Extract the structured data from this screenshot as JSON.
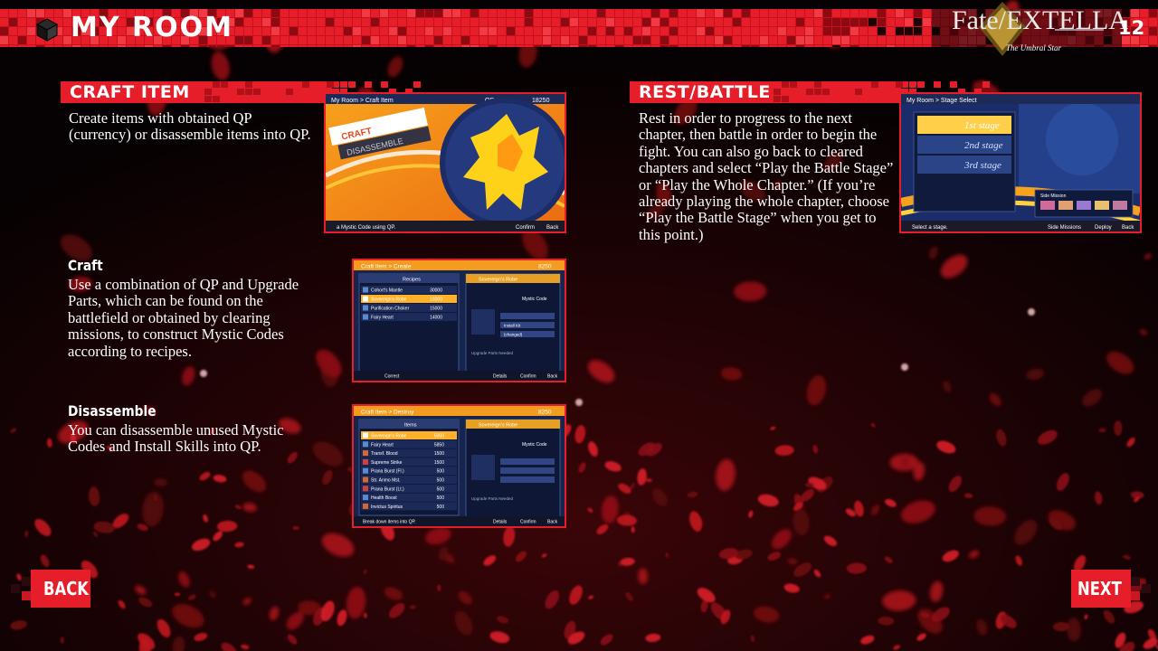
{
  "header": {
    "title": "MY ROOM",
    "page_number": "12",
    "logo": {
      "main": "Fate/EXTELLA",
      "sub": "The Umbral Star"
    }
  },
  "craft_item": {
    "heading": "CRAFT ITEM",
    "description": "Create items with obtained QP (currency) or disassemble items into QP.",
    "screenshot": {
      "breadcrumb": "My Room > Craft Item",
      "qp_label": "QP",
      "qp_value": "18250",
      "menu": [
        "CRAFT",
        "DISASSEMBLE"
      ],
      "footer_hint": "a Mystic Code using QP.",
      "footer_buttons": [
        "Confirm",
        "Back"
      ]
    }
  },
  "craft": {
    "heading": "Craft",
    "description": "Use a combination of QP and Upgrade Parts, which can be found on the battlefield or obtained by clearing missions, to construct Mystic Codes according to recipes.",
    "screenshot": {
      "breadcrumb": "Craft Item > Create",
      "qp_value": "8250",
      "list_title": "Recipes",
      "recipes": [
        {
          "name": "Cohort's Mantle",
          "cost": "30000"
        },
        {
          "name": "Sovereign's Robe",
          "cost": "15000"
        },
        {
          "name": "Purification Choker",
          "cost": "15000"
        },
        {
          "name": "Fairy Heart",
          "cost": "14000"
        }
      ],
      "detail_title": "Sovereign's Robe",
      "detail_label": "Mystic Code",
      "detail_rows": [
        "Install Kit",
        "(changed)"
      ],
      "parts_label": "Upgrade Parts Needed",
      "footer_left": "Correct",
      "footer_buttons": [
        "Details",
        "Confirm",
        "Back"
      ]
    }
  },
  "disassemble": {
    "heading": "Disassemble",
    "description": "You can disassemble unused Mystic Codes and Install Skills into QP.",
    "screenshot": {
      "breadcrumb": "Craft Item > Destroy",
      "qp_value": "8250",
      "list_title": "Items",
      "items": [
        {
          "name": "Sovereign's Robe",
          "cost": "5000"
        },
        {
          "name": "Fairy Heart",
          "cost": "5850"
        },
        {
          "name": "Transf. Blood",
          "cost": "1500"
        },
        {
          "name": "Supreme Strike",
          "cost": "1500"
        },
        {
          "name": "Prana Burst (Fl.)",
          "cost": "500"
        },
        {
          "name": "Str. Anmo Mst.",
          "cost": "500"
        },
        {
          "name": "Prana Burst (Lt.)",
          "cost": "500"
        },
        {
          "name": "Health Boost",
          "cost": "500"
        },
        {
          "name": "Invictus Spiritus",
          "cost": "500"
        }
      ],
      "detail_title": "Sovereign's Robe",
      "detail_label": "Mystic Code",
      "parts_label": "Upgrade Parts Needed",
      "footer_left": "Break down items into QP.",
      "footer_buttons": [
        "Details",
        "Confirm",
        "Back"
      ]
    }
  },
  "rest_battle": {
    "heading": "REST/BATTLE",
    "description": "Rest in order to progress to the next chapter, then battle in order to begin the fight. You can also go back to cleared chapters and select “Play the Battle Stage” or “Play the Whole Chapter.” (If you’re already playing the whole chapter, choose “Play the Battle Stage” when you get to this point.)",
    "screenshot": {
      "breadcrumb": "My Room > Stage Select",
      "stages": [
        "1st stage",
        "2nd stage",
        "3rd stage"
      ],
      "side_mission": "Side Mission",
      "footer_hint": "Select a stage.",
      "footer_buttons": [
        "Side Missions",
        "Deploy",
        "Back"
      ]
    }
  },
  "nav": {
    "back": "BACK",
    "next": "NEXT"
  },
  "colors": {
    "accent_red": "#e61e2a",
    "background": "#070203",
    "text": "#ffffff"
  }
}
